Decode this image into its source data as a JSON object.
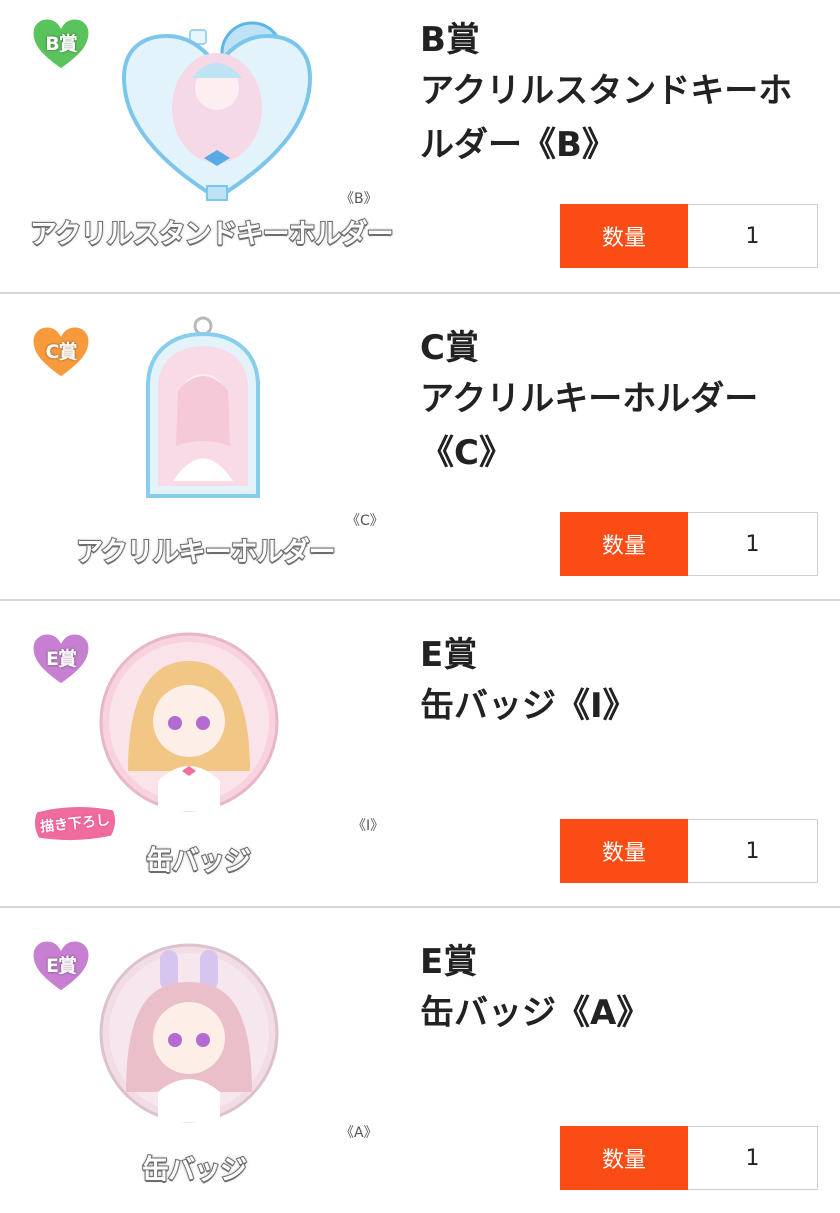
{
  "colors": {
    "accent": "#fa4c14",
    "divider": "#d6d6d6",
    "badge_b": "#5bc35b",
    "badge_c": "#f79a3c",
    "badge_e": "#c77fd1",
    "sticker": "#f06b9e"
  },
  "items": [
    {
      "badge": "B賞",
      "rank": "B賞",
      "name": "アクリルスタンドキーホルダー《B》",
      "image_caption": "アクリルスタンドキーホルダー",
      "variant_mark": "《B》",
      "quantity_label": "数量",
      "quantity_value": "1",
      "product_icon": "acrylic-stand-keychain-icon"
    },
    {
      "badge": "C賞",
      "rank": "C賞",
      "name": "アクリルキーホルダー《C》",
      "image_caption": "アクリルキーホルダー",
      "variant_mark": "《C》",
      "quantity_label": "数量",
      "quantity_value": "1",
      "product_icon": "acrylic-keychain-icon"
    },
    {
      "badge": "E賞",
      "rank": "E賞",
      "name": "缶バッジ《I》",
      "image_caption": "缶バッジ",
      "variant_mark": "《I》",
      "sticker": "描き下ろし",
      "quantity_label": "数量",
      "quantity_value": "1",
      "product_icon": "can-badge-icon"
    },
    {
      "badge": "E賞",
      "rank": "E賞",
      "name": "缶バッジ《A》",
      "image_caption": "缶バッジ",
      "variant_mark": "《A》",
      "quantity_label": "数量",
      "quantity_value": "1",
      "product_icon": "can-badge-icon"
    }
  ]
}
